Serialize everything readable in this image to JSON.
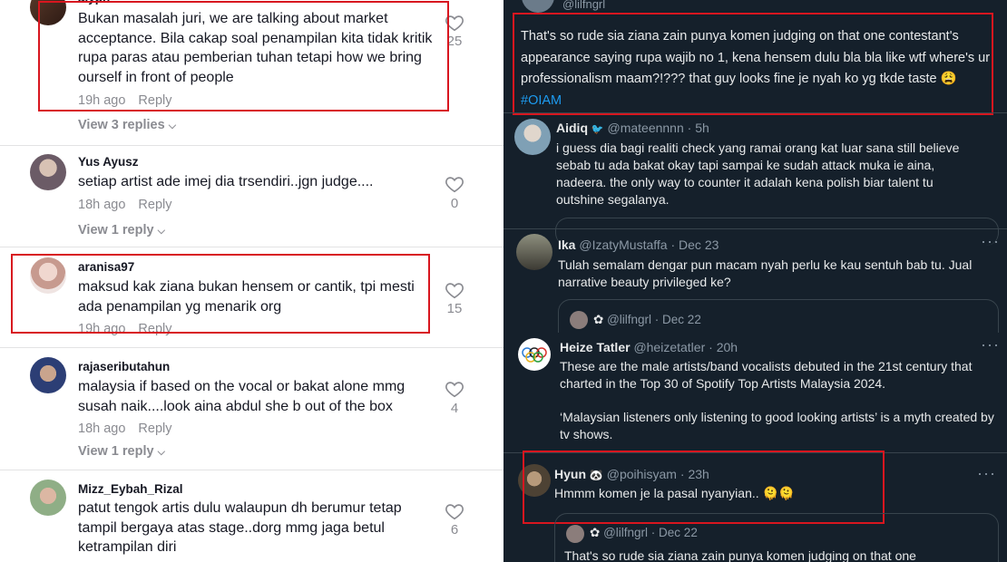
{
  "left": {
    "comments": [
      {
        "username": "aiyph",
        "text": "Bukan masalah juri, we are talking about market acceptance. Bila cakap soal penampilan kita tidak kritik rupa paras atau pemberian tuhan tetapi how we bring ourself in front of people",
        "time": "19h ago",
        "reply_label": "Reply",
        "likes": "25",
        "view_replies": "View 3 replies"
      },
      {
        "username": "Yus Ayusz",
        "text": "setiap artist ade imej dia trsendiri..jgn judge....",
        "time": "18h ago",
        "reply_label": "Reply",
        "likes": "0",
        "view_replies": "View 1 reply"
      },
      {
        "username": "aranisa97",
        "text": "maksud kak ziana bukan hensem or cantik, tpi mesti ada penampilan yg menarik org",
        "time": "19h ago",
        "reply_label": "Reply",
        "likes": "15"
      },
      {
        "username": "rajaseributahun",
        "text": "malaysia if based on the vocal or bakat alone mmg susah naik....look aina abdul she b out of the box",
        "time": "18h ago",
        "reply_label": "Reply",
        "likes": "4",
        "view_replies": "View 1 reply"
      },
      {
        "username": "Mizz_Eybah_Rizal",
        "text": "patut tengok artis dulu walaupun dh berumur tetap tampil bergaya atas stage..dorg mmg jaga betul ketrampilan diri",
        "likes": "6"
      }
    ]
  },
  "right": {
    "top_tweet": {
      "handle": "@lilfngrl",
      "text": "That's so rude sia ziana zain punya komen judging on that one contestant's appearance saying rupa wajib no 1, kena hensem dulu bla bla like wtf where's ur professionalism maam?!??? that guy looks fine je nyah ko yg tkde taste 😩",
      "hashtag": "#OIAM"
    },
    "tweets": [
      {
        "name": "Aidiq",
        "handle": "@mateennnn",
        "time": "5h",
        "text": "i guess dia bagi realiti check yang ramai orang kat luar sana still believe sebab tu ada bakat okay tapi sampai ke sudah attack muka ie aina, nadeera. the only way to counter it adalah kena polish biar talent tu outshine segalanya."
      },
      {
        "name": "Ika",
        "handle": "@IzatyMustaffa",
        "time": "Dec 23",
        "text": "Tulah semalam dengar pun macam nyah perlu ke kau sentuh bab tu. Jual narrative beauty privileged ke?",
        "quote_handle": "@lilfngrl",
        "quote_time": "Dec 22"
      },
      {
        "name": "Heize Tatler",
        "handle": "@heizetatler",
        "time": "20h",
        "text": "These are the male artists/band vocalists debuted in the 21st century that charted in the Top 30 of Spotify Top Artists Malaysia 2024.",
        "text2": "‘Malaysian listeners only listening to good looking artists’ is a myth created by tv shows."
      },
      {
        "name": "Hyun",
        "handle": "@poihisyam",
        "time": "23h",
        "text": "Hmmm komen je la pasal nyanyian..",
        "quote_handle": "@lilfngrl",
        "quote_time": "Dec 22",
        "quote_text": "That's so rude sia ziana zain punya komen judging on that one"
      }
    ],
    "more_label": "···"
  },
  "colors": {
    "highlight": "#d8161f",
    "x_bg": "#15202b",
    "x_link": "#1d9bf0"
  }
}
